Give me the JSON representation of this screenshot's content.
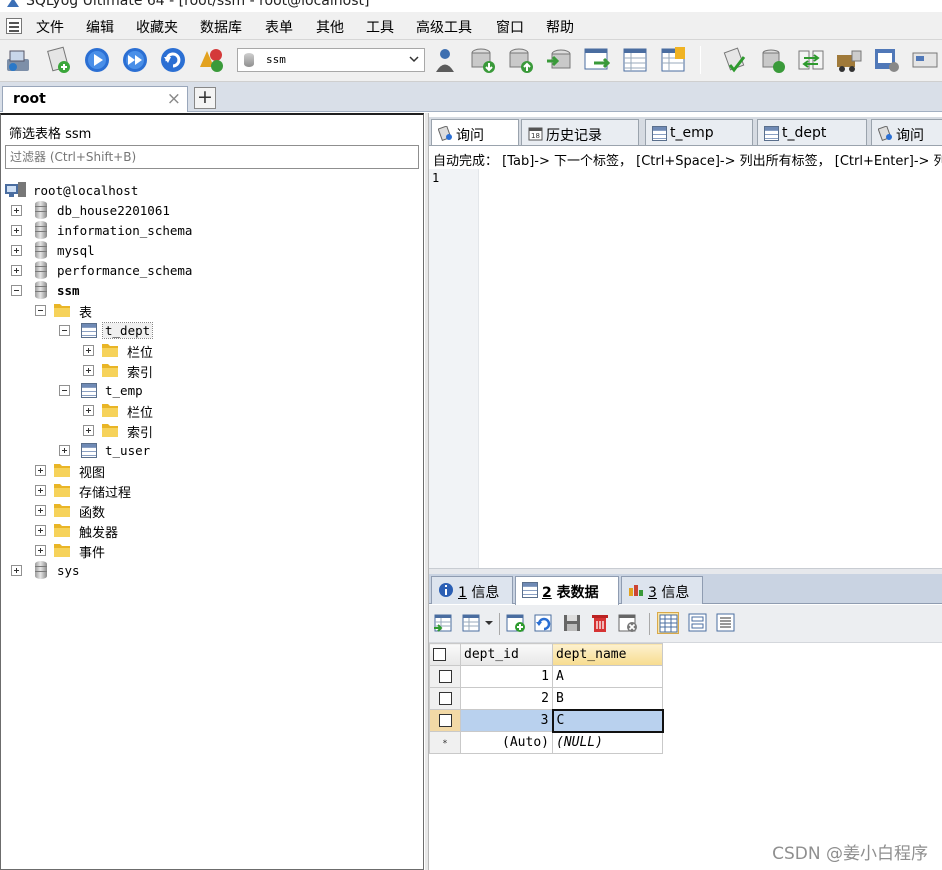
{
  "title_bar": {
    "text": "SQLyog Ultimate 64 - [root/ssm - root@localhost]"
  },
  "menu": [
    "文件",
    "编辑",
    "收藏夹",
    "数据库",
    "表单",
    "其他",
    "工具",
    "高级工具",
    "窗口",
    "帮助"
  ],
  "toolbar": {
    "database_selector": "ssm"
  },
  "connection_tab": {
    "label": "root",
    "close": "×",
    "add": "+"
  },
  "filter": {
    "label": "筛选表格 ssm",
    "placeholder": "过滤器 (Ctrl+Shift+B)"
  },
  "tree": {
    "server": "root@localhost",
    "databases": [
      "db_house2201061",
      "information_schema",
      "mysql",
      "performance_schema",
      "ssm",
      "sys"
    ],
    "tables_folder": "表",
    "t_dept": "t_dept",
    "t_emp": "t_emp",
    "t_user": "t_user",
    "columns_folder": "栏位",
    "indexes_folder": "索引",
    "views": "视图",
    "procedures": "存储过程",
    "functions": "函数",
    "triggers": "触发器",
    "events": "事件"
  },
  "query_tabs": [
    "询问",
    "历史记录",
    "t_emp",
    "t_dept",
    "询问"
  ],
  "autocomplete_hint": "自动完成： [Tab]-> 下一个标签， [Ctrl+Space]-> 列出所有标签， [Ctrl+Enter]-> 列出匹配标签",
  "editor": {
    "line_number": "1"
  },
  "result_tabs": [
    {
      "num": "1",
      "label": " 信息"
    },
    {
      "num": "2",
      "label": " 表数据"
    },
    {
      "num": "3",
      "label": " 信息"
    }
  ],
  "grid": {
    "columns": [
      "dept_id",
      "dept_name"
    ],
    "rows": [
      {
        "dept_id": "1",
        "dept_name": "A"
      },
      {
        "dept_id": "2",
        "dept_name": "B"
      },
      {
        "dept_id": "3",
        "dept_name": "C"
      }
    ],
    "new_row": {
      "marker": "*",
      "dept_id": "(Auto)",
      "dept_name": "(NULL)"
    }
  },
  "watermark": "CSDN @姜小白程序"
}
